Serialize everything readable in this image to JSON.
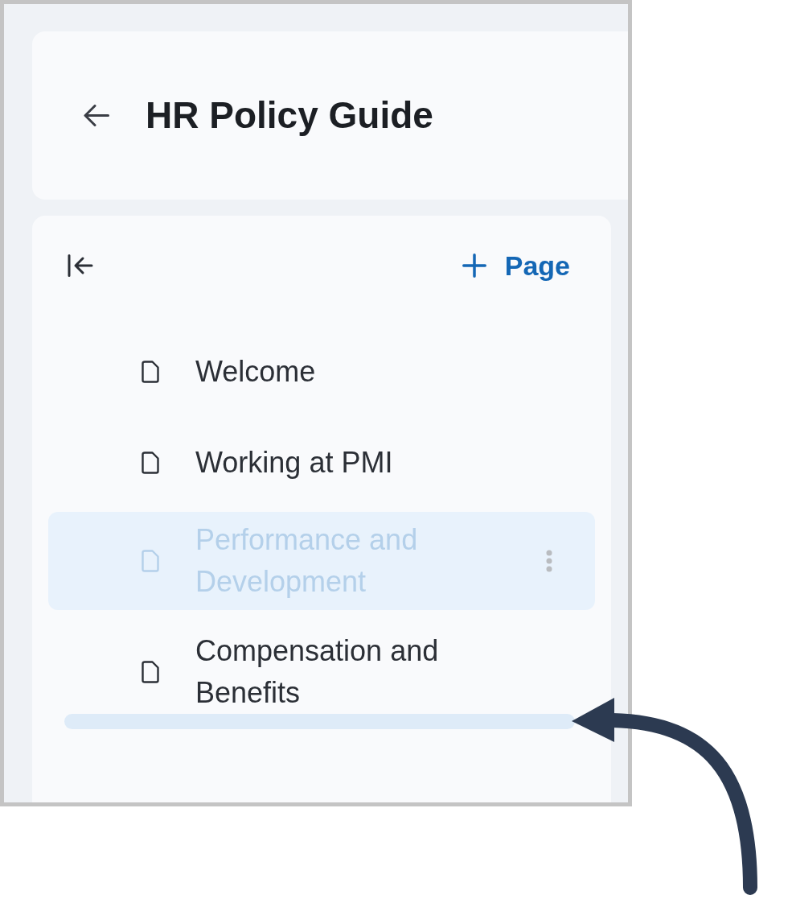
{
  "header": {
    "title": "HR Policy Guide"
  },
  "sidebar": {
    "add_page_button": {
      "label": "Page"
    },
    "pages": [
      {
        "kind": "page",
        "title": "Welcome",
        "dragging": false
      },
      {
        "kind": "page",
        "title": "Working at PMI",
        "dragging": false
      },
      {
        "kind": "page",
        "title": "Performance and Development",
        "dragging": true
      },
      {
        "kind": "page",
        "title": "Compensation and Benefits",
        "dragging": false
      },
      {
        "kind": "drop-indicator"
      }
    ]
  }
}
